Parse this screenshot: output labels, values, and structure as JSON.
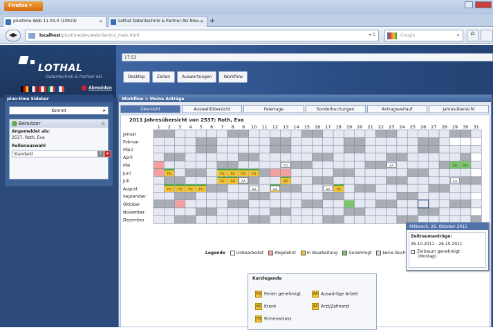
{
  "browser": {
    "menu_label": "Firefox ▾",
    "tabs": [
      {
        "label": "pluotime Web 11.04.0 (10919)"
      },
      {
        "label": "Lothal Datentechnik & Partner AG Nieu..."
      }
    ],
    "url_host": "localhost",
    "url_path": "/pluotime/dev/webclient/ui_main.html",
    "search_placeholder": "Google",
    "colors": {
      "titlebar": "#b3c6e2",
      "firefox_button": "#e07b14"
    }
  },
  "header": {
    "logo_text": "LOTHAL",
    "logo_sub": "Datentechnik & Partner AG",
    "clock": "17:53",
    "menu": [
      "Desktop",
      "Zeiten",
      "Auswertungen",
      "Workflow"
    ],
    "abmelden": "Abmelden",
    "flags": [
      {
        "icon": "flag-de",
        "colors": [
          "#000000",
          "#dd0000",
          "#ffce00"
        ]
      },
      {
        "icon": "flag-uk",
        "colors": [
          "#012169",
          "#ffffff",
          "#c8102e"
        ]
      },
      {
        "icon": "flag-ch",
        "colors": [
          "#d52b1e",
          "#ffffff",
          "#d52b1e"
        ]
      },
      {
        "icon": "flag-it",
        "colors": [
          "#009246",
          "#ffffff",
          "#ce2b37"
        ]
      },
      {
        "icon": "flag-fr",
        "colors": [
          "#0055a4",
          "#ffffff",
          "#ef4135"
        ]
      }
    ]
  },
  "sidebar": {
    "title": "pluo-time Sidebar",
    "kommt": "Kommt",
    "box_title": "Benutzer",
    "angemeldet_label": "Angemeldet als:",
    "angemeldet_value": "2537, Roth, Eva",
    "rolle_label": "Rollenauswahl",
    "rolle_value": "Standard"
  },
  "main": {
    "title": "Workflow > Meine Anträge",
    "tabs": [
      "Übersicht",
      "Auswahlübersicht",
      "Feiertage",
      "Sonderbuchungen",
      "Antragsverlauf",
      "Jahresübersicht"
    ],
    "active_tab": 0
  },
  "calendar": {
    "title": "2011 Jahresübersicht von 2537; Roth, Eva",
    "months": [
      "Januar",
      "Februar",
      "März",
      "April",
      "Mai",
      "Juni",
      "Juli",
      "August",
      "September",
      "Oktober",
      "November",
      "Dezember"
    ],
    "days": [
      "1",
      "2",
      "3",
      "4",
      "5",
      "6",
      "7",
      "8",
      "9",
      "10",
      "11",
      "12",
      "13",
      "14",
      "15",
      "16",
      "17",
      "18",
      "19",
      "20",
      "21",
      "22",
      "23",
      "24",
      "25",
      "26",
      "27",
      "28",
      "29",
      "30",
      "31"
    ],
    "legend_label": "Legende",
    "legend": [
      {
        "label": "Unbearbeitet",
        "color": "#ffffff"
      },
      {
        "label": "Abgelehnt",
        "color": "#f4a0a0"
      },
      {
        "label": "In Bearbeitung",
        "color": "#f2c230"
      },
      {
        "label": "Genehmigt",
        "color": "#7cc46c"
      },
      {
        "label": "keine Buchung",
        "color": "#dadde3"
      }
    ],
    "marks": [
      {
        "m": 4,
        "d": 1,
        "t": "red"
      },
      {
        "m": 4,
        "d": 29,
        "t": "green",
        "l": "FG"
      },
      {
        "m": 4,
        "d": 30,
        "t": "green",
        "l": "FG"
      },
      {
        "m": 5,
        "d": 1,
        "t": "bar",
        "l": "FG"
      },
      {
        "m": 5,
        "d": 2,
        "t": "bar",
        "l": "FG"
      },
      {
        "m": 5,
        "d": 7,
        "t": "bar",
        "l": "FG"
      },
      {
        "m": 5,
        "d": 8,
        "t": "bar",
        "l": "FG"
      },
      {
        "m": 5,
        "d": 9,
        "t": "bar",
        "l": "FG"
      },
      {
        "m": 5,
        "d": 10,
        "t": "bar",
        "l": "FG"
      },
      {
        "m": 4,
        "d": 13,
        "t": "box",
        "l": "FG"
      },
      {
        "m": 4,
        "d": 23,
        "t": "box",
        "l": "AA"
      },
      {
        "m": 5,
        "d": 1,
        "t": "red"
      },
      {
        "m": 5,
        "d": 12,
        "t": "red"
      },
      {
        "m": 5,
        "d": 13,
        "t": "red"
      },
      {
        "m": 6,
        "d": 7,
        "t": "bar",
        "l": "FG"
      },
      {
        "m": 6,
        "d": 8,
        "t": "bar",
        "l": "AA"
      },
      {
        "m": 6,
        "d": 9,
        "t": "box",
        "l": "AA"
      },
      {
        "m": 6,
        "d": 13,
        "t": "bar",
        "l": "AZ"
      },
      {
        "m": 6,
        "d": 29,
        "t": "box",
        "l": "AA"
      },
      {
        "m": 7,
        "d": 2,
        "t": "bar",
        "l": "FG"
      },
      {
        "m": 7,
        "d": 3,
        "t": "bar",
        "l": "FG"
      },
      {
        "m": 7,
        "d": 4,
        "t": "bar",
        "l": "FG"
      },
      {
        "m": 7,
        "d": 5,
        "t": "bar",
        "l": "FG"
      },
      {
        "m": 7,
        "d": 10,
        "t": "box",
        "l": "AA"
      },
      {
        "m": 7,
        "d": 12,
        "t": "bar",
        "l": "FG"
      },
      {
        "m": 7,
        "d": 17,
        "t": "box",
        "l": "AA"
      },
      {
        "m": 7,
        "d": 18,
        "t": "bar",
        "l": "FG"
      },
      {
        "m": 7,
        "d": 12,
        "t": "box",
        "l": "AA"
      },
      {
        "m": 9,
        "d": 3,
        "t": "red"
      },
      {
        "m": 9,
        "d": 19,
        "t": "green"
      }
    ]
  },
  "kurz_legende": {
    "title": "Kurzlegende",
    "items": [
      {
        "code": "FG",
        "label": "Ferien genehmigt"
      },
      {
        "code": "AA",
        "label": "Auswärtige Arbeit"
      },
      {
        "code": "KK",
        "label": "Krank"
      },
      {
        "code": "AZ",
        "label": "Arzt/Zahnarzt"
      },
      {
        "code": "FB",
        "label": "Firmenanlass"
      }
    ]
  },
  "tooltip": {
    "title": "Mittwoch, 26. Oktober 2011",
    "subtitle": "Zeitraumanträge:",
    "range": "26.10.2011 - 26.10.2011",
    "entry": "Zeitraum genehmigt",
    "entry_sub": "(Montag)"
  }
}
